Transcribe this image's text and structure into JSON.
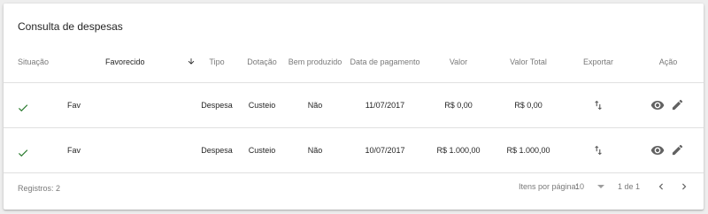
{
  "title": "Consulta de despesas",
  "columns": {
    "situacao": "Situação",
    "favorecido": "Favorecido",
    "tipo": "Tipo",
    "dotacao": "Dotação",
    "bem_produzido": "Bem produzido",
    "data_pagamento": "Data de pagamento",
    "valor": "Valor",
    "valor_total": "Valor Total",
    "exportar": "Exportar",
    "acao": "Ação"
  },
  "rows": [
    {
      "status_icon": "check-icon",
      "favorecido": "Fav",
      "tipo": "Despesa",
      "dotacao": "Custeio",
      "bem_produzido": "Não",
      "data_pagamento": "11/07/2017",
      "valor": "R$ 0,00",
      "valor_total": "R$ 0,00"
    },
    {
      "status_icon": "check-icon",
      "favorecido": "Fav",
      "tipo": "Despesa",
      "dotacao": "Custeio",
      "bem_produzido": "Não",
      "data_pagamento": "10/07/2017",
      "valor": "R$ 1.000,00",
      "valor_total": "R$ 1.000,00"
    }
  ],
  "footer": {
    "registros": "Registros: 2",
    "itens_por_pagina_label": "Itens por página:",
    "itens_por_pagina_value": "10",
    "range": "1 de 1"
  },
  "colors": {
    "check": "#2e7d32",
    "icon": "#616161",
    "divider": "#e0e0e0"
  }
}
